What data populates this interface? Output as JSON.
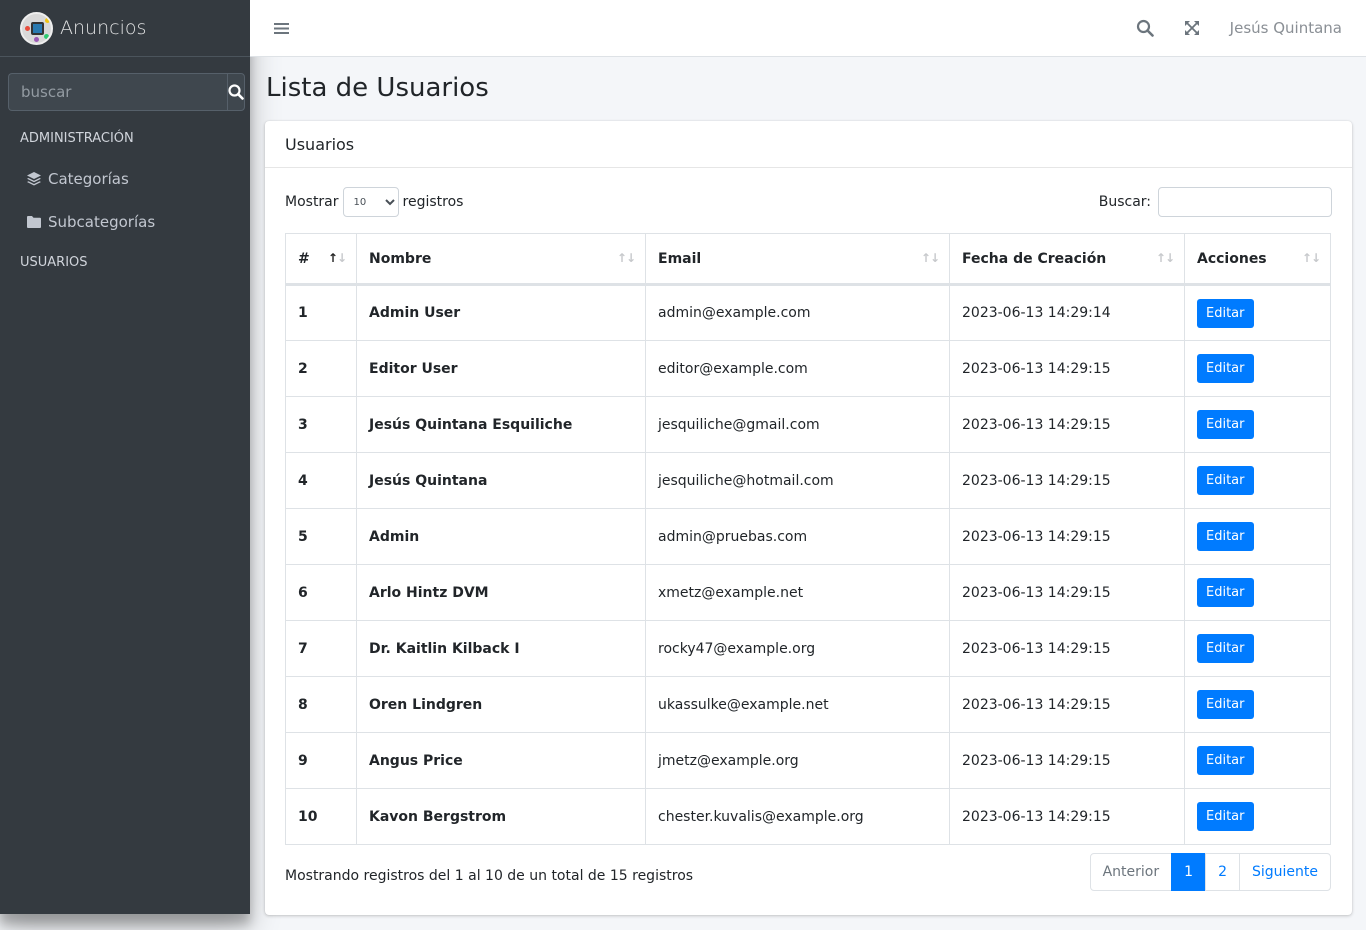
{
  "brand": {
    "name": "Anuncios"
  },
  "sidebar": {
    "search_placeholder": "buscar",
    "headers": [
      "ADMINISTRACIÓN",
      "USUARIOS"
    ],
    "items": [
      {
        "label": "Categorías",
        "icon": "layers-icon"
      },
      {
        "label": "Subcategorías",
        "icon": "folder-icon"
      }
    ]
  },
  "topbar": {
    "user": "Jesús Quintana"
  },
  "page": {
    "title": "Lista de Usuarios"
  },
  "card": {
    "title": "Usuarios",
    "length": {
      "prefix": "Mostrar",
      "value": "10",
      "suffix": "registros"
    },
    "search_label": "Buscar:",
    "columns": [
      "#",
      "Nombre",
      "Email",
      "Fecha de Creación",
      "Acciones"
    ],
    "edit_label": "Editar",
    "rows": [
      {
        "id": "1",
        "name": "Admin User",
        "email": "admin@example.com",
        "created": "2023-06-13 14:29:14"
      },
      {
        "id": "2",
        "name": "Editor User",
        "email": "editor@example.com",
        "created": "2023-06-13 14:29:15"
      },
      {
        "id": "3",
        "name": "Jesús Quintana Esquiliche",
        "email": "jesquiliche@gmail.com",
        "created": "2023-06-13 14:29:15"
      },
      {
        "id": "4",
        "name": "Jesús Quintana",
        "email": "jesquiliche@hotmail.com",
        "created": "2023-06-13 14:29:15"
      },
      {
        "id": "5",
        "name": "Admin",
        "email": "admin@pruebas.com",
        "created": "2023-06-13 14:29:15"
      },
      {
        "id": "6",
        "name": "Arlo Hintz DVM",
        "email": "xmetz@example.net",
        "created": "2023-06-13 14:29:15"
      },
      {
        "id": "7",
        "name": "Dr. Kaitlin Kilback I",
        "email": "rocky47@example.org",
        "created": "2023-06-13 14:29:15"
      },
      {
        "id": "8",
        "name": "Oren Lindgren",
        "email": "ukassulke@example.net",
        "created": "2023-06-13 14:29:15"
      },
      {
        "id": "9",
        "name": "Angus Price",
        "email": "jmetz@example.org",
        "created": "2023-06-13 14:29:15"
      },
      {
        "id": "10",
        "name": "Kavon Bergstrom",
        "email": "chester.kuvalis@example.org",
        "created": "2023-06-13 14:29:15"
      }
    ],
    "info": "Mostrando registros del 1 al 10 de un total de 15 registros",
    "pagination": {
      "prev": "Anterior",
      "pages": [
        "1",
        "2"
      ],
      "active": "1",
      "next": "Siguiente"
    }
  },
  "colors": {
    "sidebar": "#343a40",
    "primary": "#007bff",
    "background": "#f4f6f9"
  }
}
